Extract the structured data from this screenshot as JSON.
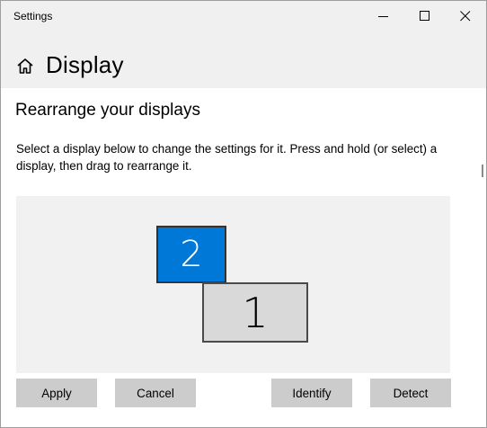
{
  "window": {
    "title": "Settings"
  },
  "header": {
    "page_title": "Display",
    "home_icon": "home-icon"
  },
  "section": {
    "heading": "Rearrange your displays",
    "description": "Select a display below to change the settings for it. Press and hold (or select) a display, then drag to rearrange it."
  },
  "displays": [
    {
      "label": "2",
      "selected": true,
      "color": "#0078d7"
    },
    {
      "label": "1",
      "selected": false,
      "color": "#d9d9d9"
    }
  ],
  "buttons": {
    "apply": "Apply",
    "cancel": "Cancel",
    "identify": "Identify",
    "detect": "Detect"
  },
  "colors": {
    "accent": "#0078d7",
    "button_bg": "#cccccc",
    "chrome_bg": "#f0f0f0"
  }
}
